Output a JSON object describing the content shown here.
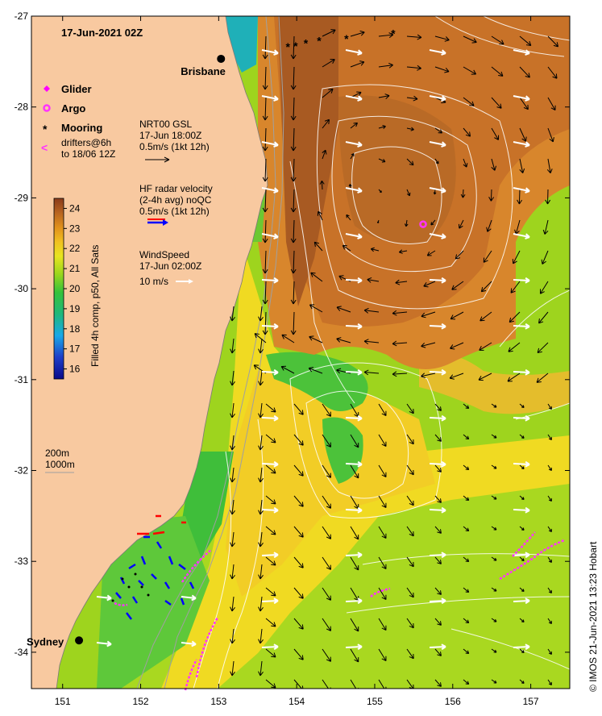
{
  "title": "17-Jun-2021 02Z",
  "cities": [
    {
      "name": "Brisbane",
      "lon": 153.03,
      "lat": -27.47,
      "label_dx": -50,
      "label_dy": 20
    },
    {
      "name": "Sydney",
      "lon": 151.21,
      "lat": -33.87,
      "label_dx": -65,
      "label_dy": 6
    }
  ],
  "legend": {
    "glider": "Glider",
    "argo": "Argo",
    "mooring": "Mooring",
    "drifters_line1": "drifters@6h",
    "drifters_line2": "to 18/06 12Z",
    "drifter_marker": "<"
  },
  "vector_keys": {
    "nrt": [
      "NRT00 GSL",
      "17-Jun 18:00Z",
      "0.5m/s (1kt 12h)"
    ],
    "hf": [
      "HF radar velocity",
      "(2-4h avg) noQC",
      "0.5m/s (1kt 12h)"
    ],
    "wind": [
      "WindSpeed",
      "17-Jun 02:00Z",
      "10 m/s"
    ]
  },
  "isobaths": [
    "200m",
    "1000m"
  ],
  "colorbar": {
    "label": "Filled 4h comp, p50, All Sats",
    "min": 15.5,
    "max": 24.5,
    "ticks": [
      16,
      17,
      18,
      19,
      20,
      21,
      22,
      23,
      24
    ]
  },
  "axes": {
    "lon_range": [
      150.6,
      157.5
    ],
    "lat_range": [
      -34.4,
      -27.0
    ],
    "lon_ticks": [
      151,
      152,
      153,
      154,
      155,
      156,
      157
    ],
    "lat_ticks": [
      -27,
      -28,
      -29,
      -30,
      -31,
      -32,
      -33,
      -34
    ]
  },
  "credit": "© IMOS 21-Jun-2021 13:23 Hobart",
  "colors": {
    "land": "#f8c9a0",
    "glider": "#ff00ff",
    "argo": "#ff33ff",
    "mooring": "#000000",
    "hf_red": "#ff0000",
    "hf_blue": "#0000ff",
    "wind": "#ffffff",
    "current": "#000000"
  },
  "moorings": [
    {
      "lon": 153.9,
      "lat": -27.33
    },
    {
      "lon": 154.0,
      "lat": -27.32
    },
    {
      "lon": 154.13,
      "lat": -27.29
    },
    {
      "lon": 154.3,
      "lat": -27.26
    },
    {
      "lon": 154.65,
      "lat": -27.24
    },
    {
      "lon": 155.25,
      "lat": -27.18
    }
  ],
  "argo_floats": [
    {
      "lon": 155.62,
      "lat": -29.29
    }
  ]
}
